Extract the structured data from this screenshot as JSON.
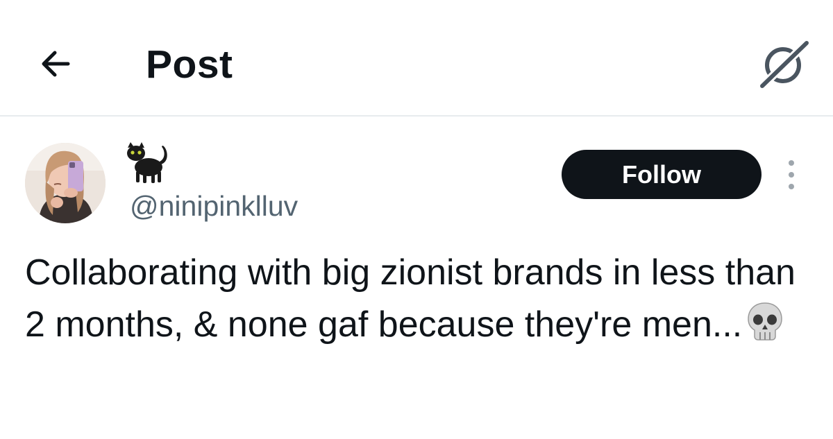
{
  "header": {
    "title": "Post",
    "back_icon": "arrow-left-icon",
    "grok_icon": "grok-icon"
  },
  "author": {
    "display_name_icon": "black-cat-emoji",
    "handle": "@ninipinklluv",
    "avatar": "profile-photo"
  },
  "actions": {
    "follow_label": "Follow",
    "more_icon": "more-vertical-icon"
  },
  "post": {
    "text": "Collaborating with big zionist brands in less than 2 months, & none gaf because they're men...",
    "emoji": "skull-emoji"
  },
  "colors": {
    "text": "#0f1419",
    "secondary_text": "#536471",
    "follow_button_bg": "#0f1419",
    "follow_button_text": "#ffffff",
    "divider": "#e7ebee"
  }
}
